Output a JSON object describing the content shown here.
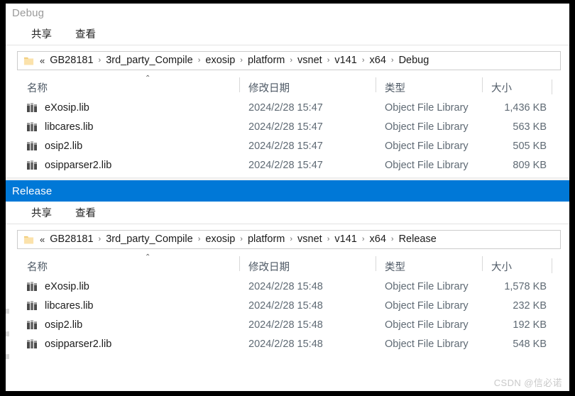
{
  "windows": [
    {
      "title": "Debug",
      "title_state": "inactive",
      "accent": "#0078d7",
      "ribbon_tabs": [
        {
          "label": "共享"
        },
        {
          "label": "查看"
        }
      ],
      "address": {
        "folder_icon": "folder-icon",
        "overflow": "«",
        "separator": "›",
        "crumbs": [
          "GB28181",
          "3rd_party_Compile",
          "exosip",
          "platform",
          "vsnet",
          "v141",
          "x64",
          "Debug"
        ]
      },
      "columns": {
        "name": "名称",
        "date": "修改日期",
        "type": "类型",
        "size": "大小",
        "sort_indicator": "⌃"
      },
      "files": [
        {
          "icon": "library-file-icon",
          "name": "eXosip.lib",
          "date": "2024/2/28 15:47",
          "type": "Object File Library",
          "size": "1,436 KB"
        },
        {
          "icon": "library-file-icon",
          "name": "libcares.lib",
          "date": "2024/2/28 15:47",
          "type": "Object File Library",
          "size": "563 KB"
        },
        {
          "icon": "library-file-icon",
          "name": "osip2.lib",
          "date": "2024/2/28 15:47",
          "type": "Object File Library",
          "size": "505 KB"
        },
        {
          "icon": "library-file-icon",
          "name": "osipparser2.lib",
          "date": "2024/2/28 15:47",
          "type": "Object File Library",
          "size": "809 KB"
        }
      ]
    },
    {
      "title": "Release",
      "title_state": "active",
      "accent": "#0078d7",
      "ribbon_tabs": [
        {
          "label": "共享"
        },
        {
          "label": "查看"
        }
      ],
      "address": {
        "folder_icon": "folder-icon",
        "overflow": "«",
        "separator": "›",
        "crumbs": [
          "GB28181",
          "3rd_party_Compile",
          "exosip",
          "platform",
          "vsnet",
          "v141",
          "x64",
          "Release"
        ]
      },
      "columns": {
        "name": "名称",
        "date": "修改日期",
        "type": "类型",
        "size": "大小",
        "sort_indicator": "⌃"
      },
      "files": [
        {
          "icon": "library-file-icon",
          "name": "eXosip.lib",
          "date": "2024/2/28 15:48",
          "type": "Object File Library",
          "size": "1,578 KB"
        },
        {
          "icon": "library-file-icon",
          "name": "libcares.lib",
          "date": "2024/2/28 15:48",
          "type": "Object File Library",
          "size": "232 KB"
        },
        {
          "icon": "library-file-icon",
          "name": "osip2.lib",
          "date": "2024/2/28 15:48",
          "type": "Object File Library",
          "size": "192 KB"
        },
        {
          "icon": "library-file-icon",
          "name": "osipparser2.lib",
          "date": "2024/2/28 15:48",
          "type": "Object File Library",
          "size": "548 KB"
        }
      ]
    }
  ],
  "watermark": "CSDN @信必诺"
}
